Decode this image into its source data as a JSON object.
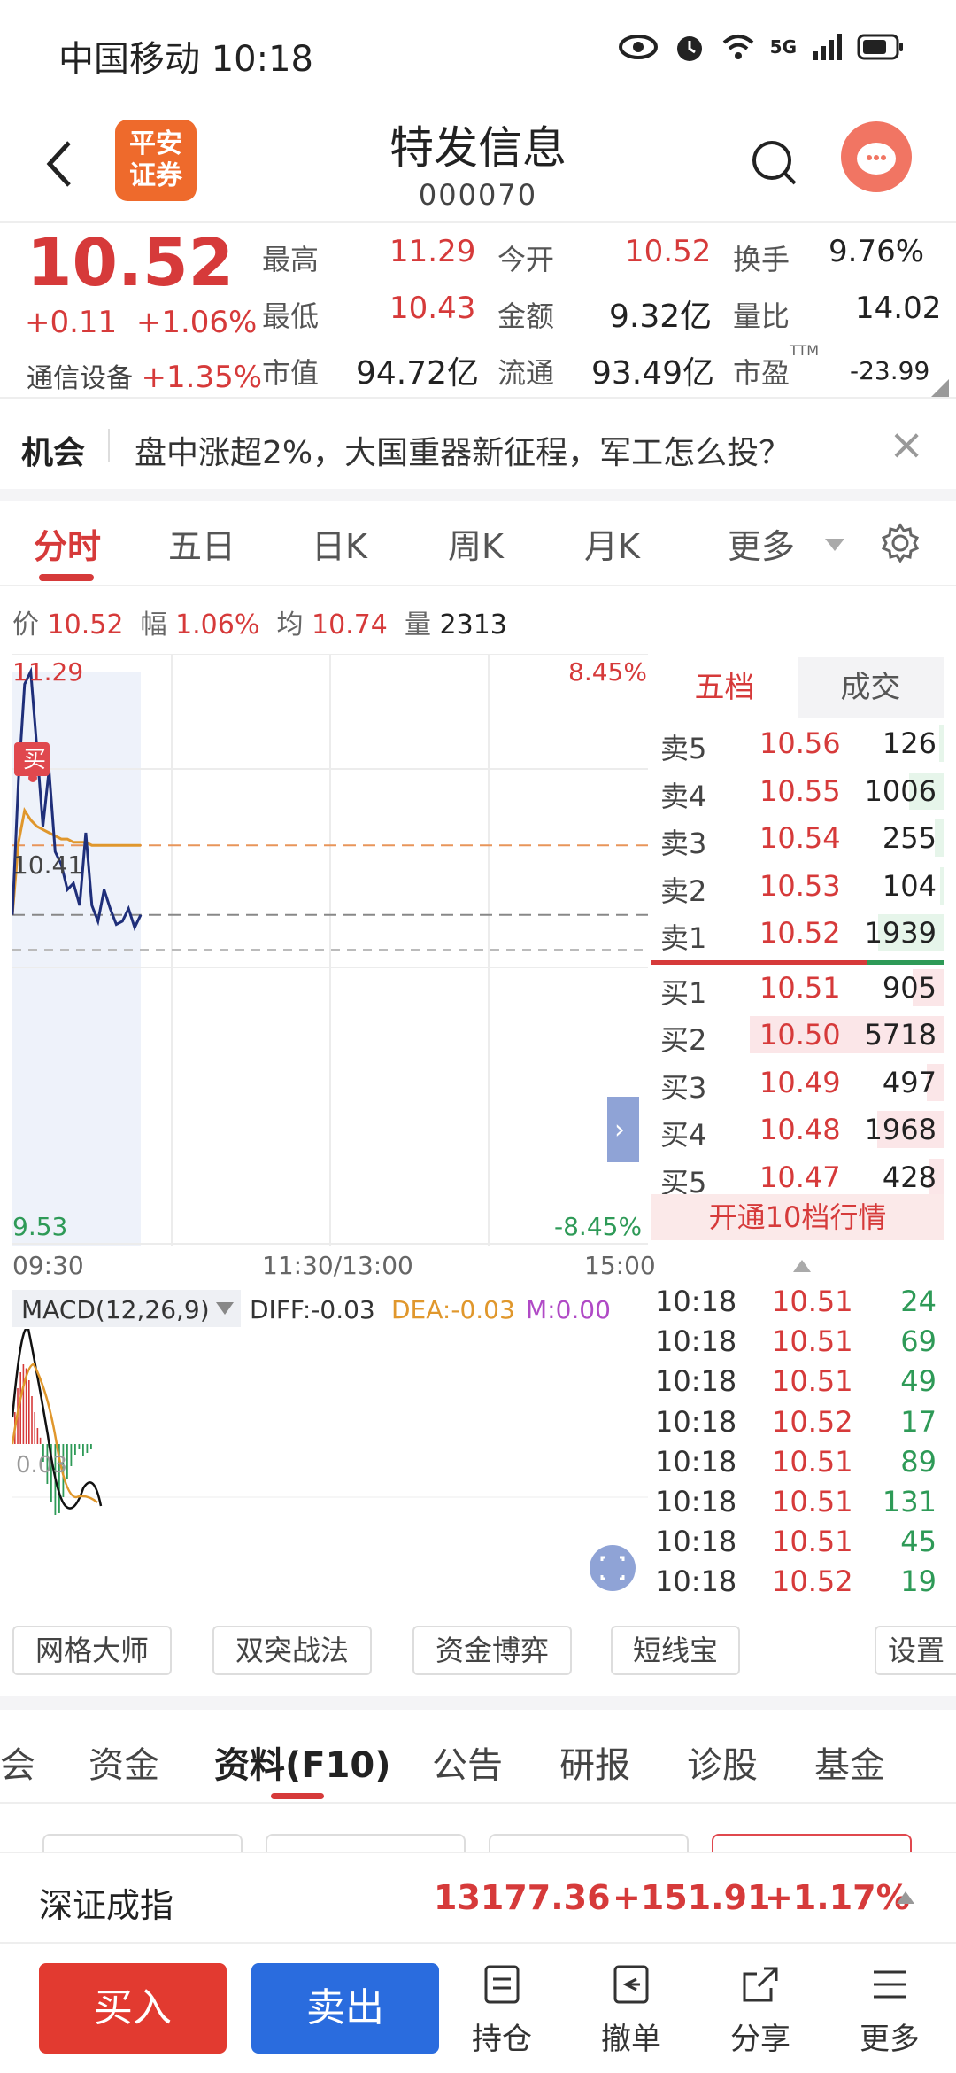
{
  "status_bar": {
    "carrier_time": "中国移动 10:18",
    "network": "5G"
  },
  "header": {
    "logo_text": "平安证券",
    "title": "特发信息",
    "code": "000070"
  },
  "quote": {
    "price": "10.52",
    "change": "+0.11",
    "change_pct": "+1.06%",
    "sector_name": "通信设备",
    "sector_pct": "+1.35%",
    "high_label": "最高",
    "high": "11.29",
    "low_label": "最低",
    "low": "10.43",
    "mcap_label": "市值",
    "mcap": "94.72亿",
    "open_label": "今开",
    "open": "10.52",
    "amount_label": "金额",
    "amount": "9.32亿",
    "float_label": "流通",
    "float": "93.49亿",
    "turnover_label": "换手",
    "turnover": "9.76%",
    "vol_ratio_label": "量比",
    "vol_ratio": "14.02",
    "pe_label": "市盈",
    "pe_sup": "TTM",
    "pe": "-23.99"
  },
  "banner": {
    "tag": "机会",
    "text": "盘中涨超2%，大国重器新征程，军工怎么投？"
  },
  "tabs": [
    "分时",
    "五日",
    "日K",
    "周K",
    "月K",
    "更多"
  ],
  "info_line": {
    "price_label": "价",
    "price": "10.52",
    "pct_label": "幅",
    "pct": "1.06%",
    "avg_label": "均",
    "avg": "10.74",
    "vol_label": "量",
    "vol": "2313"
  },
  "chart_labels": {
    "top_left": "11.29",
    "top_right": "8.45%",
    "mid_left": "10.41",
    "bottom_left": "9.53",
    "bottom_right": "-8.45%",
    "buy_marker": "买"
  },
  "chart_data": {
    "type": "line",
    "series": [
      {
        "values": [
          10.52,
          10.95,
          11.25,
          11.29,
          11.05,
          10.8,
          10.98,
          10.72,
          10.68,
          10.6,
          10.62,
          10.55,
          10.78,
          10.55,
          10.5,
          10.6,
          10.54,
          10.49,
          10.5,
          10.54,
          10.48,
          10.52
        ]
      },
      {
        "values": [
          10.52,
          10.75,
          10.85,
          10.82,
          10.8,
          10.79,
          10.78,
          10.77,
          10.76,
          10.76,
          10.75,
          10.75,
          10.75,
          10.74,
          10.74,
          10.74,
          10.74,
          10.74,
          10.74,
          10.74,
          10.74,
          10.74
        ]
      }
    ],
    "ylim": [
      9.53,
      11.29
    ],
    "prev_close": 10.41
  },
  "timeline": {
    "start": "09:30",
    "mid": "11:30/13:00",
    "end": "15:00"
  },
  "order_book": {
    "tab1": "五档",
    "tab2": "成交",
    "asks": [
      {
        "label": "卖5",
        "price": "10.56",
        "vol": "126"
      },
      {
        "label": "卖4",
        "price": "10.55",
        "vol": "1006"
      },
      {
        "label": "卖3",
        "price": "10.54",
        "vol": "255"
      },
      {
        "label": "卖2",
        "price": "10.53",
        "vol": "104"
      },
      {
        "label": "卖1",
        "price": "10.52",
        "vol": "1939"
      }
    ],
    "bids": [
      {
        "label": "买1",
        "price": "10.51",
        "vol": "905"
      },
      {
        "label": "买2",
        "price": "10.50",
        "vol": "5718"
      },
      {
        "label": "买3",
        "price": "10.49",
        "vol": "497"
      },
      {
        "label": "买4",
        "price": "10.48",
        "vol": "1968"
      },
      {
        "label": "买5",
        "price": "10.47",
        "vol": "428"
      }
    ],
    "open_level10": "开通10档行情"
  },
  "macd": {
    "name": "MACD(12,26,9)",
    "diff": "DIFF:-0.03",
    "dea": "DEA:-0.03",
    "m": "M:0.00",
    "axis_label": "0.03"
  },
  "ticks": [
    {
      "time": "10:18",
      "price": "10.51",
      "vol": "24"
    },
    {
      "time": "10:18",
      "price": "10.51",
      "vol": "69"
    },
    {
      "time": "10:18",
      "price": "10.51",
      "vol": "49"
    },
    {
      "time": "10:18",
      "price": "10.52",
      "vol": "17"
    },
    {
      "time": "10:18",
      "price": "10.51",
      "vol": "89"
    },
    {
      "time": "10:18",
      "price": "10.51",
      "vol": "131"
    },
    {
      "time": "10:18",
      "price": "10.51",
      "vol": "45"
    },
    {
      "time": "10:18",
      "price": "10.52",
      "vol": "19"
    }
  ],
  "tools": {
    "grid": "网格大师",
    "double": "双突战法",
    "fund": "资金博弈",
    "short": "短线宝",
    "settings": "设置"
  },
  "lower_tabs": [
    "会",
    "资金",
    "资料(F10)",
    "公告",
    "研报",
    "诊股",
    "基金"
  ],
  "index_bar": {
    "name": "深证成指",
    "value": "13177.36",
    "change": "+151.91",
    "pct": "+1.17%"
  },
  "bottom_bar": {
    "buy": "买入",
    "sell": "卖出",
    "position": "持仓",
    "cancel": "撤单",
    "share": "分享",
    "more": "更多"
  },
  "colors": {
    "up": "#d63a3a",
    "down": "#2e9a57",
    "buy_button": "#e23a30",
    "sell_button": "#2a6cde",
    "price_line": "#1f2f7a",
    "avg_line": "#e0972c"
  }
}
